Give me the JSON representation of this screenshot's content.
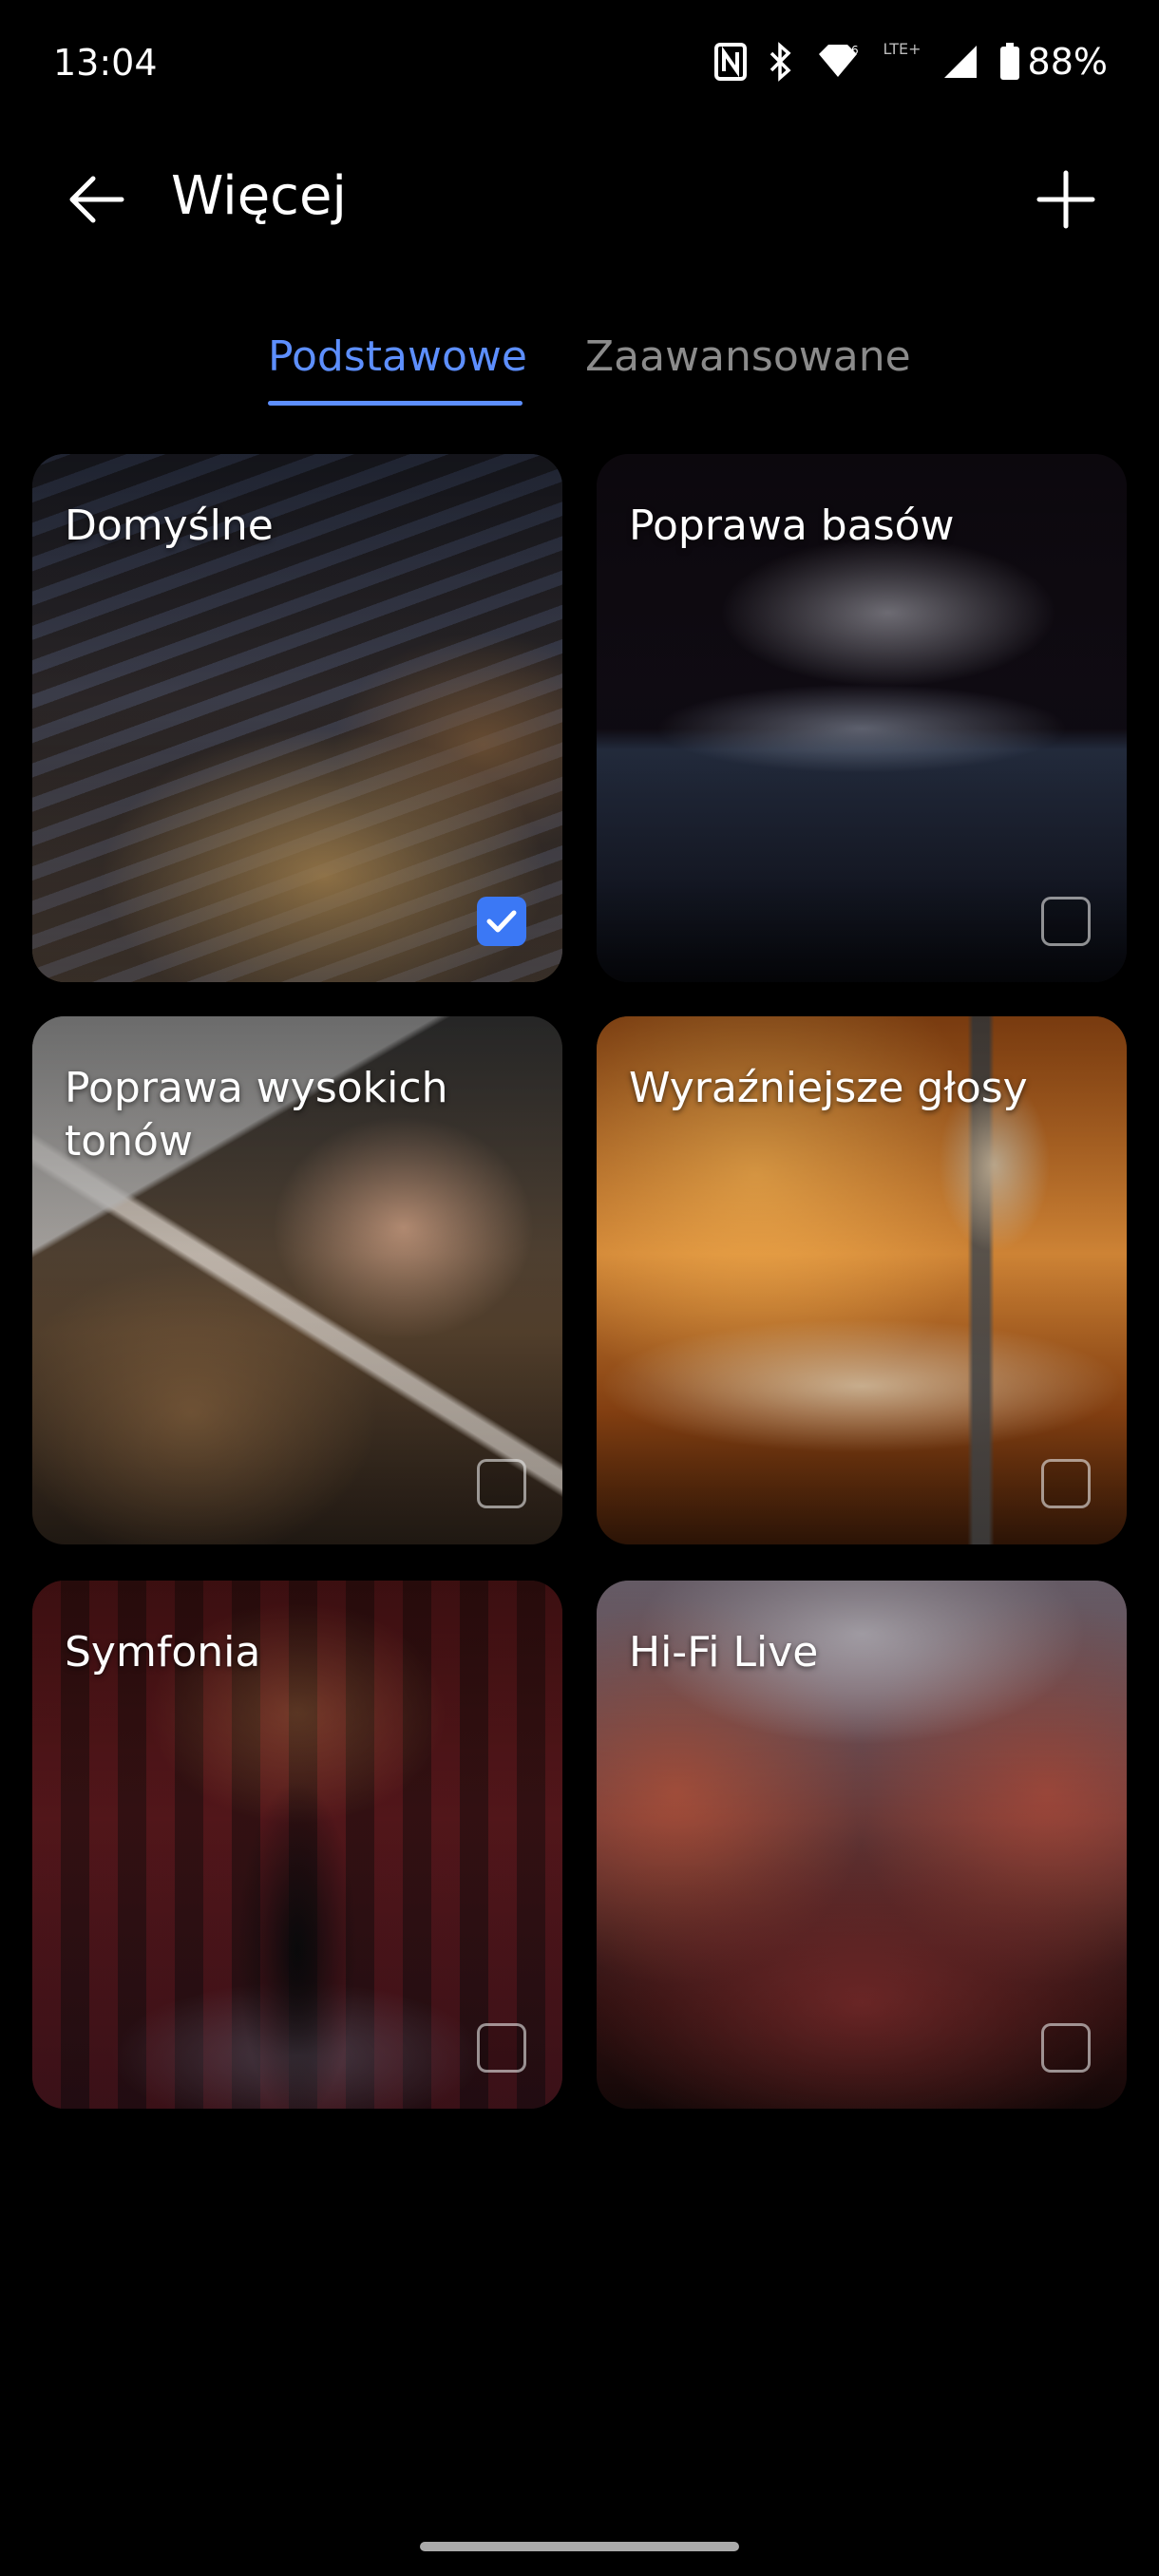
{
  "status_bar": {
    "time": "13:04",
    "network": "LTE+",
    "battery": "88%"
  },
  "header": {
    "title": "Więcej"
  },
  "tabs": [
    {
      "label": "Podstawowe",
      "selected": true
    },
    {
      "label": "Zaawansowane",
      "selected": false
    }
  ],
  "presets": [
    {
      "label": "Domyślne",
      "checked": true
    },
    {
      "label": "Poprawa basów",
      "checked": false
    },
    {
      "label": "Poprawa wysokich tonów",
      "checked": false
    },
    {
      "label": "Wyraźniejsze głosy",
      "checked": false
    },
    {
      "label": "Symfonia",
      "checked": false
    },
    {
      "label": "Hi-Fi Live",
      "checked": false
    }
  ],
  "colors": {
    "accent": "#5d8fff",
    "checkbox_on": "#3b78f5",
    "background": "#000000"
  }
}
